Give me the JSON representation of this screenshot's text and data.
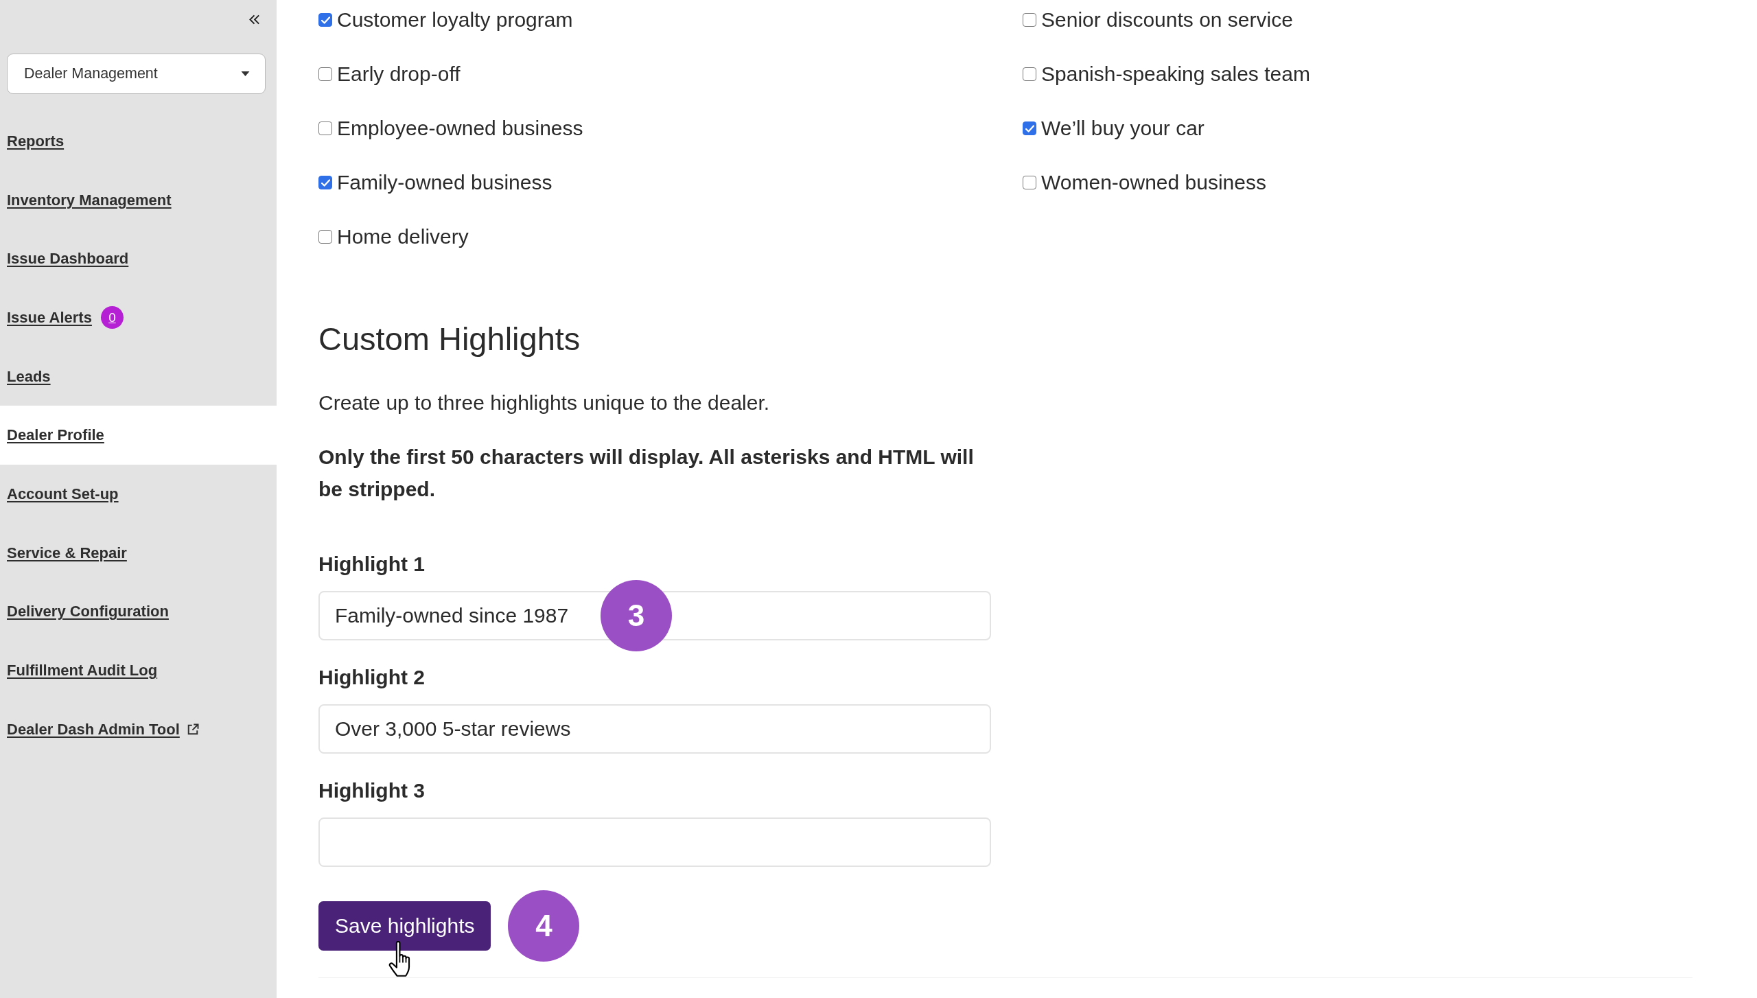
{
  "sidebar": {
    "dropdown": {
      "value": "Dealer Management"
    },
    "items": [
      {
        "label": "Reports",
        "kind": "link",
        "selected": false
      },
      {
        "label": "Inventory Management",
        "kind": "link",
        "selected": false
      },
      {
        "label": "Issue Dashboard",
        "kind": "link",
        "selected": false
      },
      {
        "label": "Issue Alerts",
        "kind": "link",
        "selected": false,
        "badge": "0"
      },
      {
        "label": "Leads",
        "kind": "link",
        "selected": false
      },
      {
        "label": "Dealer Profile",
        "kind": "link",
        "selected": true
      },
      {
        "label": "Account Set-up",
        "kind": "link",
        "selected": false
      },
      {
        "label": "Service & Repair",
        "kind": "link",
        "selected": false
      },
      {
        "label": "Delivery Configuration",
        "kind": "link",
        "selected": false
      },
      {
        "label": "Fulfillment Audit Log",
        "kind": "link",
        "selected": false
      },
      {
        "label": "Dealer Dash Admin Tool",
        "kind": "external",
        "selected": false
      }
    ]
  },
  "features": {
    "columns": [
      [
        {
          "label": "Customer loyalty program",
          "checked": true
        },
        {
          "label": "Early drop-off",
          "checked": false
        },
        {
          "label": "Employee-owned business",
          "checked": false
        },
        {
          "label": "Family-owned business",
          "checked": true
        },
        {
          "label": "Home delivery",
          "checked": false
        }
      ],
      [
        {
          "label": "Senior discounts on service",
          "checked": false
        },
        {
          "label": "Spanish-speaking sales team",
          "checked": false
        },
        {
          "label": "We’ll buy your car",
          "checked": true
        },
        {
          "label": "Women-owned business",
          "checked": false
        }
      ]
    ]
  },
  "custom_highlights": {
    "title": "Custom Highlights",
    "intro": "Create up to three highlights unique to the dealer.",
    "note": "Only the first 50 characters will display. All asterisks and HTML will be stripped.",
    "fields": [
      {
        "label": "Highlight 1",
        "value": "Family-owned since 1987",
        "step": "3"
      },
      {
        "label": "Highlight 2",
        "value": "Over 3,000 5-star reviews"
      },
      {
        "label": "Highlight 3"
      }
    ],
    "save_button": {
      "label": "Save highlights",
      "step": "4"
    }
  }
}
